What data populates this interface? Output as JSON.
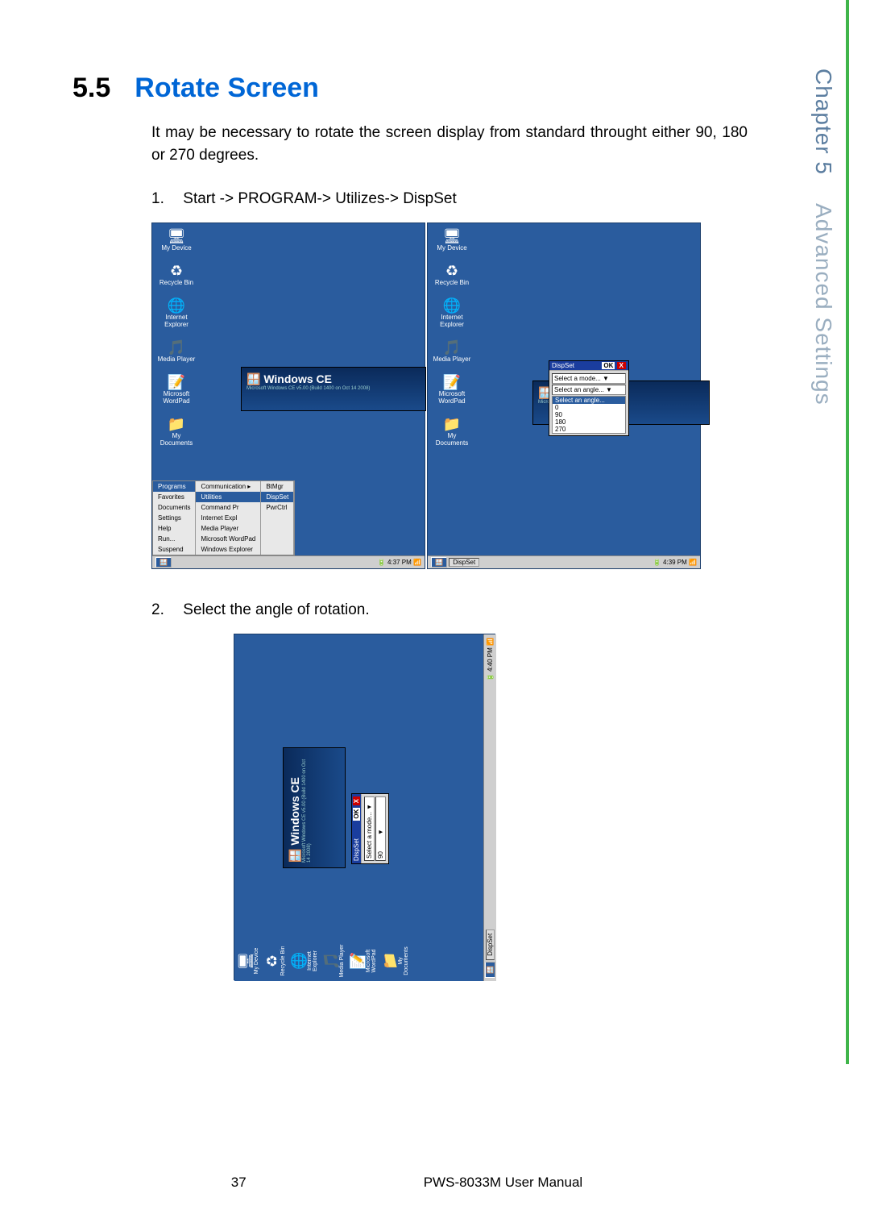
{
  "section_number": "5.5",
  "section_title": "Rotate Screen",
  "paragraph": "It may be necessary to rotate the screen display from standard throught either 90, 180 or 270 degrees.",
  "step1_num": "1.",
  "step1_text": "Start -> PROGRAM-> Utilizes-> DispSet",
  "step2_num": "2.",
  "step2_text": "Select the angle of rotation.",
  "side_chapter": "Chapter 5",
  "side_title": "Advanced Settings",
  "page_number": "37",
  "manual_name": "PWS-8033M User Manual",
  "shot": {
    "icons": [
      {
        "glyph": "🖥",
        "label": "My Device"
      },
      {
        "glyph": "♻",
        "label": "Recycle Bin"
      },
      {
        "glyph": "🌐",
        "label": "Internet Explorer"
      },
      {
        "glyph": "🎵",
        "label": "Media Player"
      },
      {
        "glyph": "📝",
        "label": "Microsoft WordPad"
      },
      {
        "glyph": "📁",
        "label": "My Documents"
      }
    ],
    "splash_brand": "Windows CE",
    "splash_sub": "Microsoft Windows CE v5.00 (Build 1400 on Oct 14 2008)",
    "start_menu_col1": [
      "Programs",
      "Favorites",
      "Documents",
      "Settings",
      "Help",
      "Run...",
      "Suspend"
    ],
    "start_menu_col2": [
      "Communication   ▸",
      "Utilities",
      "Command Pr",
      "Internet Expl",
      "Media Player",
      "Microsoft WordPad",
      "Windows Explorer"
    ],
    "start_menu_col3": [
      "BtMgr",
      "DispSet",
      "PwrCtrl"
    ],
    "taskbar_time_1": "4:37 PM",
    "taskbar_time_2": "4:39 PM",
    "taskbar_time_3": "4:40 PM",
    "taskbar_app": "DispSet"
  },
  "dispset": {
    "title": "DispSet",
    "ok": "OK",
    "close": "X",
    "mode_label": "Select a mode...  ▼",
    "angle_label": "Select an angle... ▼",
    "angle_prompt": "Select an angle...",
    "options": [
      "0",
      "90",
      "180",
      "270"
    ],
    "ms_text": "Microsoft Windo",
    "shot3_selected": "90"
  }
}
